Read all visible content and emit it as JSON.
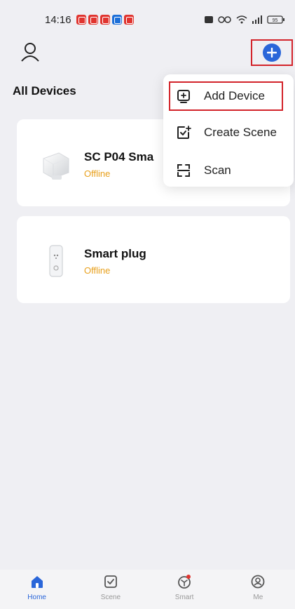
{
  "status_bar": {
    "time": "14:16",
    "battery": "95"
  },
  "header": {
    "profile_icon": "person-outline-icon",
    "add_icon": "plus-circle-icon"
  },
  "page": {
    "title": "All Devices"
  },
  "devices": [
    {
      "name": "SC P04 Sma",
      "status": "Offline",
      "icon": "smart-plug-white-icon"
    },
    {
      "name": "Smart plug",
      "status": "Offline",
      "icon": "smart-plug-switch-icon"
    }
  ],
  "menu": {
    "items": [
      {
        "label": "Add Device",
        "icon": "add-device-icon"
      },
      {
        "label": "Create Scene",
        "icon": "create-scene-icon"
      },
      {
        "label": "Scan",
        "icon": "scan-icon"
      }
    ]
  },
  "tabbar": {
    "tabs": [
      {
        "label": "Home",
        "icon": "home-icon",
        "active": true
      },
      {
        "label": "Scene",
        "icon": "scene-icon",
        "active": false
      },
      {
        "label": "Smart",
        "icon": "smart-icon",
        "active": false
      },
      {
        "label": "Me",
        "icon": "me-icon",
        "active": false
      }
    ]
  },
  "colors": {
    "accent": "#2a66d9",
    "offline": "#e8a01c",
    "highlight": "#d3232a",
    "background": "#efeff3"
  }
}
